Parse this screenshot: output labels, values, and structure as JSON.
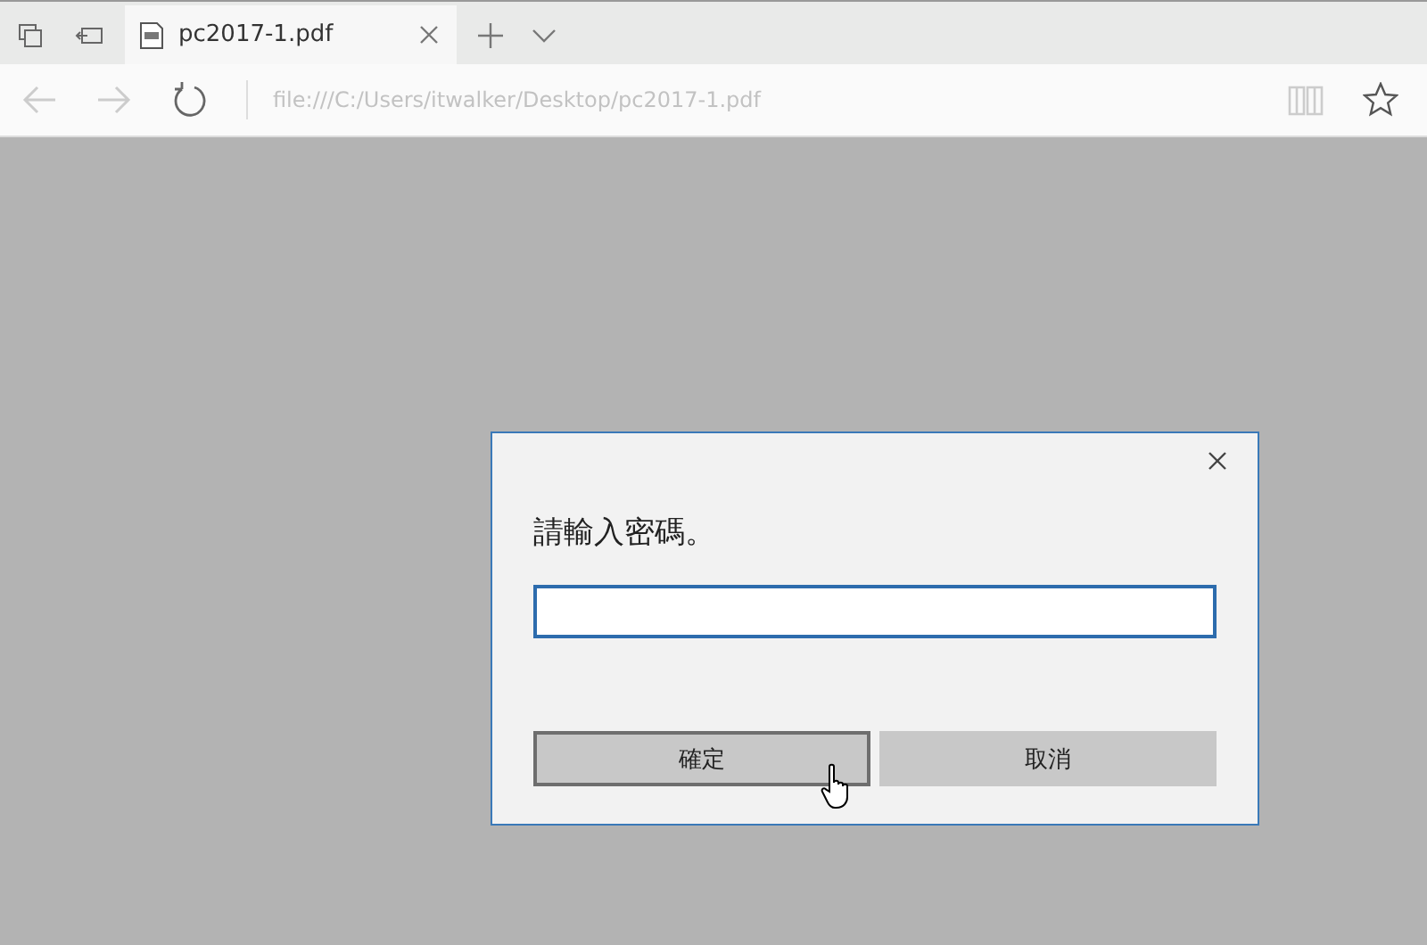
{
  "tab_bar": {
    "tabs": [
      {
        "title": "pc2017-1.pdf",
        "selected": true
      }
    ]
  },
  "address_bar": {
    "back": {
      "disabled": true
    },
    "forward": {
      "disabled": true
    },
    "url": "file:///C:/Users/itwalker/Desktop/pc2017-1.pdf",
    "reading_view": {
      "disabled": true
    }
  },
  "dialog": {
    "message": "請輸入密碼。",
    "buttons": [
      {
        "label": "確定",
        "focused": true
      },
      {
        "label": "取消",
        "focused": false
      }
    ]
  }
}
